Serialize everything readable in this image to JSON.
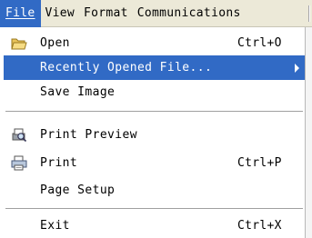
{
  "menubar": {
    "items": [
      {
        "label": "File",
        "active": true
      },
      {
        "label": "View"
      },
      {
        "label": "Format"
      },
      {
        "label": "Communications"
      }
    ]
  },
  "file_menu": {
    "open": {
      "label": "Open",
      "shortcut": "Ctrl+O",
      "icon": "open-folder-icon"
    },
    "recent": {
      "label": "Recently Opened File...",
      "icon": "submenu-arrow-icon"
    },
    "save_image": {
      "label": "Save Image"
    },
    "print_preview": {
      "label": "Print Preview",
      "icon": "print-preview-icon"
    },
    "print": {
      "label": "Print",
      "shortcut": "Ctrl+P",
      "icon": "printer-icon"
    },
    "page_setup": {
      "label": "Page Setup"
    },
    "exit": {
      "label": "Exit",
      "shortcut": "Ctrl+X"
    }
  },
  "colors": {
    "highlight": "#316ac5",
    "menubar_bg": "#ece9d8"
  }
}
